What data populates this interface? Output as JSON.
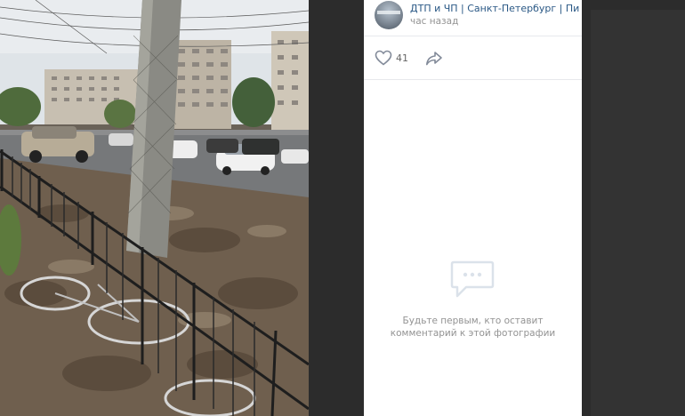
{
  "post": {
    "author_name": "ДТП и ЧП | Санкт-Петербург | Пите...",
    "time": "час назад",
    "likes": "41"
  },
  "comments": {
    "empty_line1": "Будьте первым, кто оставит",
    "empty_line2": "комментарий к этой фотографии"
  },
  "icons": {
    "like": "heart-icon",
    "share": "share-arrow-icon",
    "empty_comments": "comment-bubble-icon"
  },
  "colors": {
    "link": "#2a5885",
    "muted": "#939393",
    "icon": "#828a99",
    "empty_icon": "#dbe2ea"
  }
}
